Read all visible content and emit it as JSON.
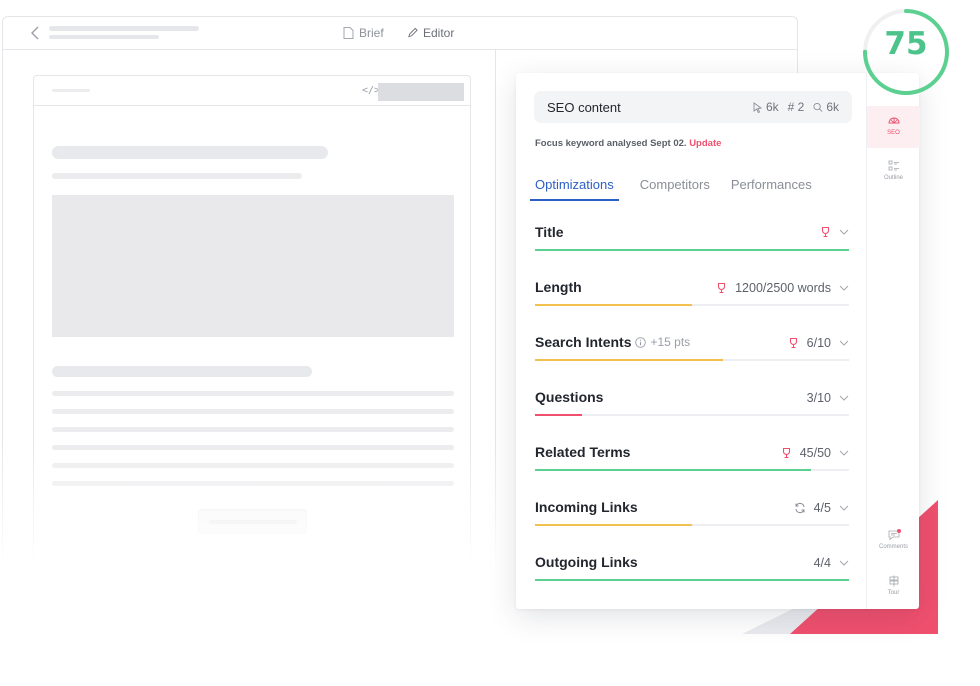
{
  "editor": {
    "tabs": [
      {
        "label": "Brief",
        "icon": "document-icon"
      },
      {
        "label": "Editor",
        "icon": "pencil-icon"
      }
    ],
    "code_icon": "</>"
  },
  "score": {
    "value": "75",
    "fraction": 0.75,
    "color": "#4cc38a"
  },
  "seo": {
    "keyword": "SEO content",
    "metrics": [
      {
        "icon": "cursor-icon",
        "value": "6k"
      },
      {
        "icon": "rank-icon",
        "value": "# 2"
      },
      {
        "icon": "search-icon",
        "value": "6k"
      }
    ],
    "focus_text": "Focus keyword analysed Sept 02.",
    "update_label": "Update",
    "tabs": [
      "Optimizations",
      "Competitors",
      "Performances"
    ],
    "active_tab": "Optimizations",
    "sections": [
      {
        "name": "Title",
        "value": "",
        "bonus": "",
        "icon": "trophy-icon",
        "progress": 1.0,
        "color": "#5cd090"
      },
      {
        "name": "Length",
        "value": "1200/2500 words",
        "bonus": "",
        "icon": "trophy-icon",
        "progress": 0.5,
        "color": "#f2c14e"
      },
      {
        "name": "Search Intents",
        "value": "6/10",
        "bonus": "+15 pts",
        "icon": "trophy-icon",
        "progress": 0.6,
        "color": "#f2c14e"
      },
      {
        "name": "Questions",
        "value": "3/10",
        "bonus": "",
        "icon": "",
        "progress": 0.15,
        "color": "#f0506e"
      },
      {
        "name": "Related Terms",
        "value": "45/50",
        "bonus": "",
        "icon": "trophy-icon",
        "progress": 0.88,
        "color": "#5cd090"
      },
      {
        "name": "Incoming Links",
        "value": "4/5",
        "bonus": "",
        "icon": "refresh-icon",
        "progress": 0.5,
        "color": "#f2c14e"
      },
      {
        "name": "Outgoing Links",
        "value": "4/4",
        "bonus": "",
        "icon": "",
        "progress": 1.0,
        "color": "#5cd090"
      }
    ],
    "rail": [
      {
        "label": "SEO",
        "icon": "gauge-icon",
        "active": true
      },
      {
        "label": "Outline",
        "icon": "outline-icon",
        "active": false
      },
      {
        "label": "Comments",
        "icon": "comment-icon",
        "active": false
      },
      {
        "label": "Tour",
        "icon": "signpost-icon",
        "active": false
      }
    ]
  },
  "colors": {
    "accent": "#2c5fc5",
    "danger": "#f0506e",
    "success": "#5cd090",
    "warning": "#f2c14e"
  }
}
